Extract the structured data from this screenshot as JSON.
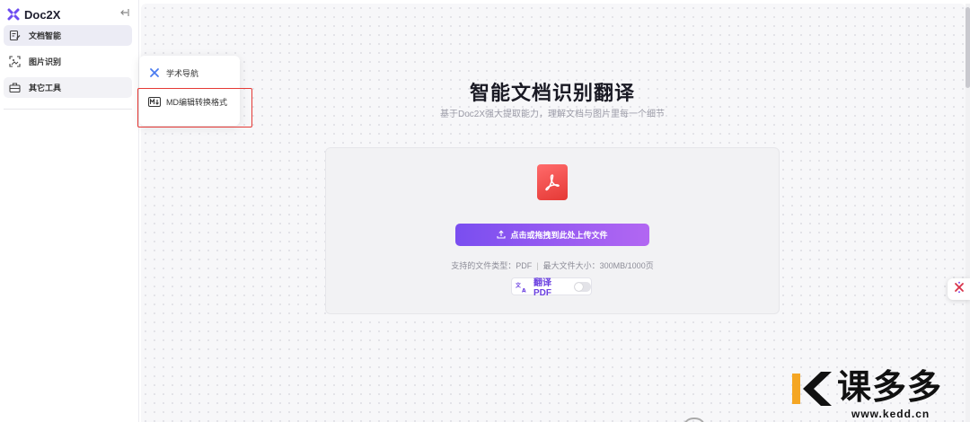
{
  "brand": {
    "name": "Doc2X"
  },
  "sidebar": {
    "collapse_icon": "collapse-left-icon",
    "items": [
      {
        "label": "文档智能",
        "icon": "document-edit-icon",
        "state": "active"
      },
      {
        "label": "图片识别",
        "icon": "image-scan-icon",
        "state": "normal"
      },
      {
        "label": "其它工具",
        "icon": "toolbox-icon",
        "state": "hover"
      }
    ]
  },
  "flyout": {
    "items": [
      {
        "label": "学术导航",
        "icon": "sparkle-icon"
      },
      {
        "label": "MD编辑转换格式",
        "icon": "markdown-icon"
      }
    ]
  },
  "hero": {
    "title": "智能文档识别翻译",
    "subtitle": "基于Doc2X强大提取能力，理解文档与图片里每一个细节"
  },
  "upload": {
    "button_label": "点击或拖拽到此处上传文件",
    "supported_types": "支持的文件类型：PDF",
    "max_size": "最大文件大小：300MB/1000页",
    "translate_label": "翻译 PDF",
    "translate_enabled": false
  },
  "colors": {
    "accent_start": "#7a4ef0",
    "accent_end": "#b267f2",
    "pdf_red": "#e53935",
    "highlight_red": "#e53935"
  },
  "watermark": {
    "text": "课多多",
    "url": "www.kedd.cn"
  }
}
